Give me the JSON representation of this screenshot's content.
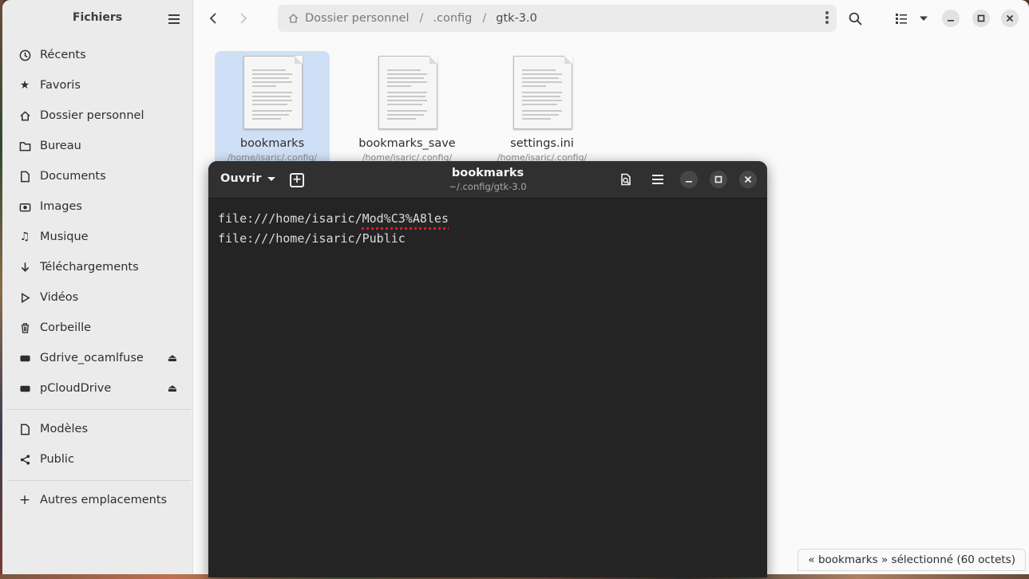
{
  "files_app": {
    "sidebar": {
      "title": "Fichiers",
      "items": [
        {
          "label": "Récents",
          "icon": "clock-icon"
        },
        {
          "label": "Favoris",
          "icon": "star-icon"
        },
        {
          "label": "Dossier personnel",
          "icon": "home-icon"
        },
        {
          "label": "Bureau",
          "icon": "folder-icon"
        },
        {
          "label": "Documents",
          "icon": "document-icon"
        },
        {
          "label": "Images",
          "icon": "camera-icon"
        },
        {
          "label": "Musique",
          "icon": "music-icon"
        },
        {
          "label": "Téléchargements",
          "icon": "download-icon"
        },
        {
          "label": "Vidéos",
          "icon": "video-icon"
        },
        {
          "label": "Corbeille",
          "icon": "trash-icon"
        },
        {
          "label": "Gdrive_ocamlfuse",
          "icon": "drive-icon"
        },
        {
          "label": "pCloudDrive",
          "icon": "drive-icon"
        },
        {
          "label": "Modèles",
          "icon": "document-icon"
        },
        {
          "label": "Public",
          "icon": "share-icon"
        },
        {
          "label": "Autres emplacements",
          "icon": "plus-icon"
        }
      ]
    },
    "pathbar": {
      "segments": [
        "Dossier personnel",
        ".config",
        "gtk-3.0"
      ],
      "separator": "/"
    },
    "files": [
      {
        "name": "bookmarks",
        "path": "/home/isaric/.config/",
        "selected": true
      },
      {
        "name": "bookmarks_save",
        "path": "/home/isaric/.config/",
        "selected": false
      },
      {
        "name": "settings.ini",
        "path": "/home/isaric/.config/",
        "selected": false
      }
    ],
    "status": "« bookmarks » sélectionné  (60 octets)"
  },
  "editor": {
    "open_label": "Ouvrir",
    "title": "bookmarks",
    "subtitle": "~/.config/gtk-3.0",
    "lines": [
      {
        "prefix": "file:///home/isaric/",
        "word": "Mod%C3%A8les"
      },
      {
        "prefix": "file:///home/isaric/Public",
        "word": ""
      }
    ]
  },
  "colors": {
    "selection": "#cfe0f6",
    "spellcheck": "#e01b24",
    "editor_bg": "#242424"
  }
}
